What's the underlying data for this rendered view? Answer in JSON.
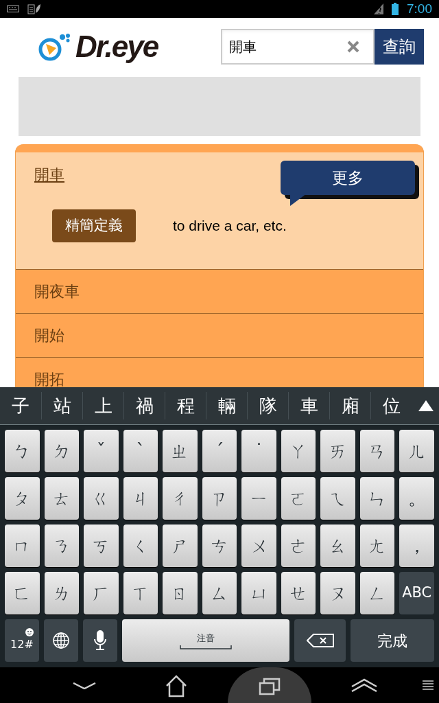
{
  "status_bar": {
    "time": "7:00"
  },
  "header": {
    "logo": "Dr.eye",
    "search": {
      "value": "開車",
      "button": "查詢"
    }
  },
  "results": [
    {
      "word": "開車",
      "expanded": true,
      "more_button": "更多",
      "badge": "精簡定義",
      "definition": "to drive a car, etc."
    },
    {
      "word": "開夜車",
      "expanded": false
    },
    {
      "word": "開始",
      "expanded": false
    },
    {
      "word": "開拓",
      "expanded": false
    }
  ],
  "keyboard": {
    "candidates": [
      "子",
      "站",
      "上",
      "禍",
      "程",
      "輛",
      "隊",
      "車",
      "廂",
      "位"
    ],
    "rows": [
      [
        {
          "kind": "char",
          "label": "ㄅ"
        },
        {
          "kind": "char",
          "label": "ㄉ"
        },
        {
          "kind": "char",
          "label": "ˇ"
        },
        {
          "kind": "char",
          "label": "ˋ"
        },
        {
          "kind": "char",
          "label": "ㄓ"
        },
        {
          "kind": "char",
          "label": "ˊ"
        },
        {
          "kind": "char",
          "label": "˙"
        },
        {
          "kind": "char",
          "label": "ㄚ"
        },
        {
          "kind": "char",
          "label": "ㄞ"
        },
        {
          "kind": "char",
          "label": "ㄢ"
        },
        {
          "kind": "char",
          "label": "ㄦ"
        }
      ],
      [
        {
          "kind": "char",
          "label": "ㄆ"
        },
        {
          "kind": "char",
          "label": "ㄊ"
        },
        {
          "kind": "char",
          "label": "ㄍ"
        },
        {
          "kind": "char",
          "label": "ㄐ"
        },
        {
          "kind": "char",
          "label": "ㄔ"
        },
        {
          "kind": "char",
          "label": "ㄗ"
        },
        {
          "kind": "char",
          "label": "ㄧ"
        },
        {
          "kind": "char",
          "label": "ㄛ"
        },
        {
          "kind": "char",
          "label": "ㄟ"
        },
        {
          "kind": "char",
          "label": "ㄣ"
        },
        {
          "kind": "char",
          "label": "。"
        }
      ],
      [
        {
          "kind": "char",
          "label": "ㄇ"
        },
        {
          "kind": "char",
          "label": "ㄋ"
        },
        {
          "kind": "char",
          "label": "ㄎ"
        },
        {
          "kind": "char",
          "label": "ㄑ"
        },
        {
          "kind": "char",
          "label": "ㄕ"
        },
        {
          "kind": "char",
          "label": "ㄘ"
        },
        {
          "kind": "char",
          "label": "ㄨ"
        },
        {
          "kind": "char",
          "label": "ㄜ"
        },
        {
          "kind": "char",
          "label": "ㄠ"
        },
        {
          "kind": "char",
          "label": "ㄤ"
        },
        {
          "kind": "char",
          "label": "，"
        }
      ],
      [
        {
          "kind": "char",
          "label": "ㄈ"
        },
        {
          "kind": "char",
          "label": "ㄌ"
        },
        {
          "kind": "char",
          "label": "ㄏ"
        },
        {
          "kind": "char",
          "label": "ㄒ"
        },
        {
          "kind": "char",
          "label": "ㄖ"
        },
        {
          "kind": "char",
          "label": "ㄙ"
        },
        {
          "kind": "char",
          "label": "ㄩ"
        },
        {
          "kind": "char",
          "label": "ㄝ"
        },
        {
          "kind": "char",
          "label": "ㄡ"
        },
        {
          "kind": "char",
          "label": "ㄥ"
        },
        {
          "kind": "mode",
          "label": "ABC"
        }
      ]
    ],
    "symbols_key": "12#",
    "space_label": "注音",
    "done_key": "完成"
  }
}
